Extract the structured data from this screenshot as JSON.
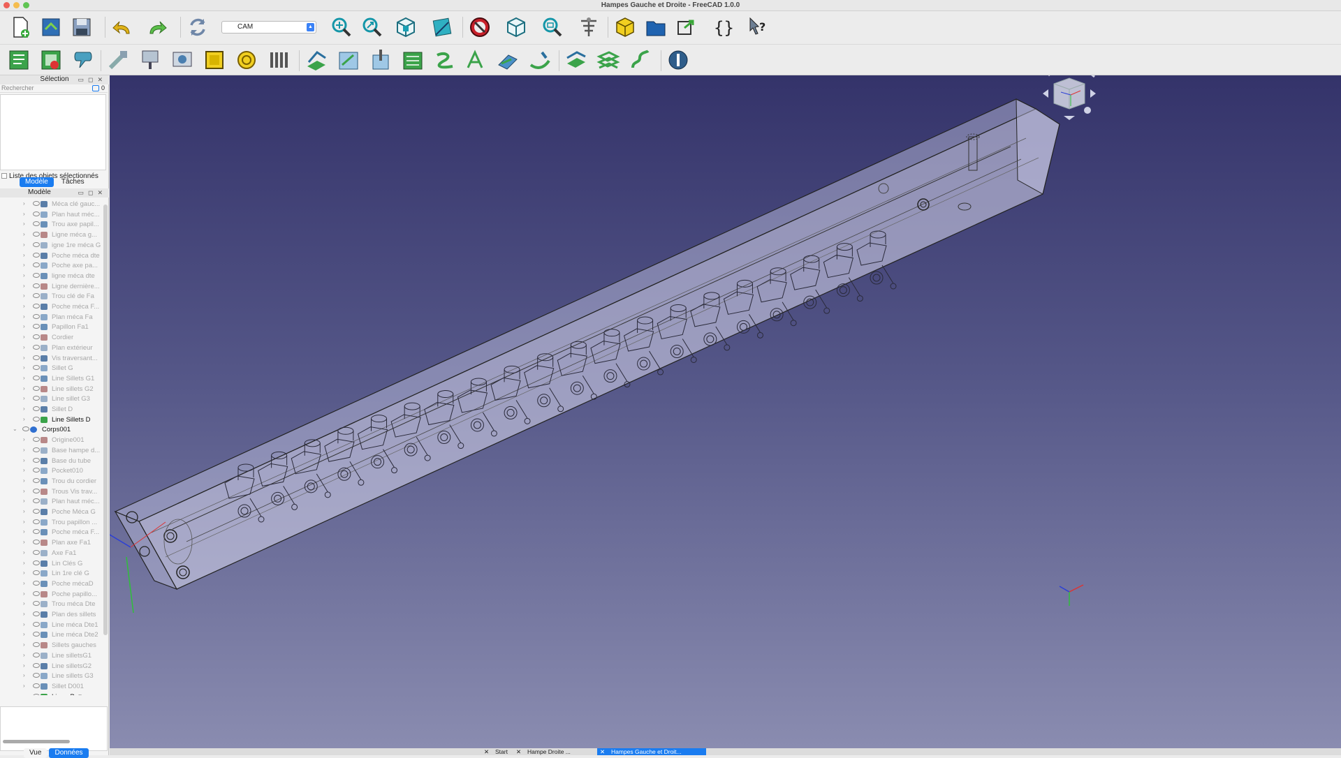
{
  "window": {
    "title": "Hampes Gauche et Droite - FreeCAD 1.0.0"
  },
  "toolbar": {
    "workbench": "CAM"
  },
  "selection_panel": {
    "title": "Sélection",
    "search_placeholder": "Rechercher",
    "count": "0",
    "checkbox_label": "Liste des objets sélectionnés",
    "tabs": [
      "Modèle",
      "Tâches"
    ]
  },
  "model_panel": {
    "title": "Modèle",
    "items": [
      {
        "label": "Méca clé gauc..."
      },
      {
        "label": "Plan haut méc..."
      },
      {
        "label": "Trou axe papil..."
      },
      {
        "label": "Ligne méca g..."
      },
      {
        "label": "igne 1re méca G"
      },
      {
        "label": "Poche méca dte"
      },
      {
        "label": "Poche axe pa..."
      },
      {
        "label": "ligne méca dte"
      },
      {
        "label": "Ligne dernière..."
      },
      {
        "label": "Trou clé de Fa"
      },
      {
        "label": "Poche méca F..."
      },
      {
        "label": "Plan méca Fa"
      },
      {
        "label": "Papillon Fa1"
      },
      {
        "label": "Cordier"
      },
      {
        "label": "Plan extérieur"
      },
      {
        "label": "Vis traversant..."
      },
      {
        "label": "Sillet G"
      },
      {
        "label": "Line Sillets G1"
      },
      {
        "label": "Line sillets G2"
      },
      {
        "label": "Line sillet G3"
      },
      {
        "label": "Sillet D"
      },
      {
        "label": "Line Sillets D"
      },
      {
        "label": "Corps001"
      },
      {
        "label": "Origine001"
      },
      {
        "label": "Base hampe d..."
      },
      {
        "label": "Base du tube"
      },
      {
        "label": "Pocket010"
      },
      {
        "label": "Trou du cordier"
      },
      {
        "label": "Trous Vis trav..."
      },
      {
        "label": "Plan haut méc..."
      },
      {
        "label": "Poche Méca G"
      },
      {
        "label": "Trou papillon ..."
      },
      {
        "label": "Poche méca F..."
      },
      {
        "label": "Plan axe Fa1"
      },
      {
        "label": "Axe Fa1"
      },
      {
        "label": "Lin Clés G"
      },
      {
        "label": "Lin 1re clé G"
      },
      {
        "label": "Poche mécaD"
      },
      {
        "label": "Poche papillo..."
      },
      {
        "label": "Trou méca Dte"
      },
      {
        "label": "Plan des sillets"
      },
      {
        "label": "Line méca Dte1"
      },
      {
        "label": "Line méca Dte2"
      },
      {
        "label": "Sillets gauches"
      },
      {
        "label": "Line silletsG1"
      },
      {
        "label": "Line silletsG2"
      },
      {
        "label": "Line sillets G3"
      },
      {
        "label": "Sillet D001"
      },
      {
        "label": "LinearPattern..."
      }
    ]
  },
  "property_tabs": [
    "Vue",
    "Données"
  ],
  "document_tabs": [
    "Start",
    "Hampe Droite ...",
    "Hampes Gauche et Droit..."
  ],
  "colors": {
    "accent": "#1a7cf0",
    "viewport_top": "#34336a",
    "viewport_bottom": "#8a8cb0"
  }
}
